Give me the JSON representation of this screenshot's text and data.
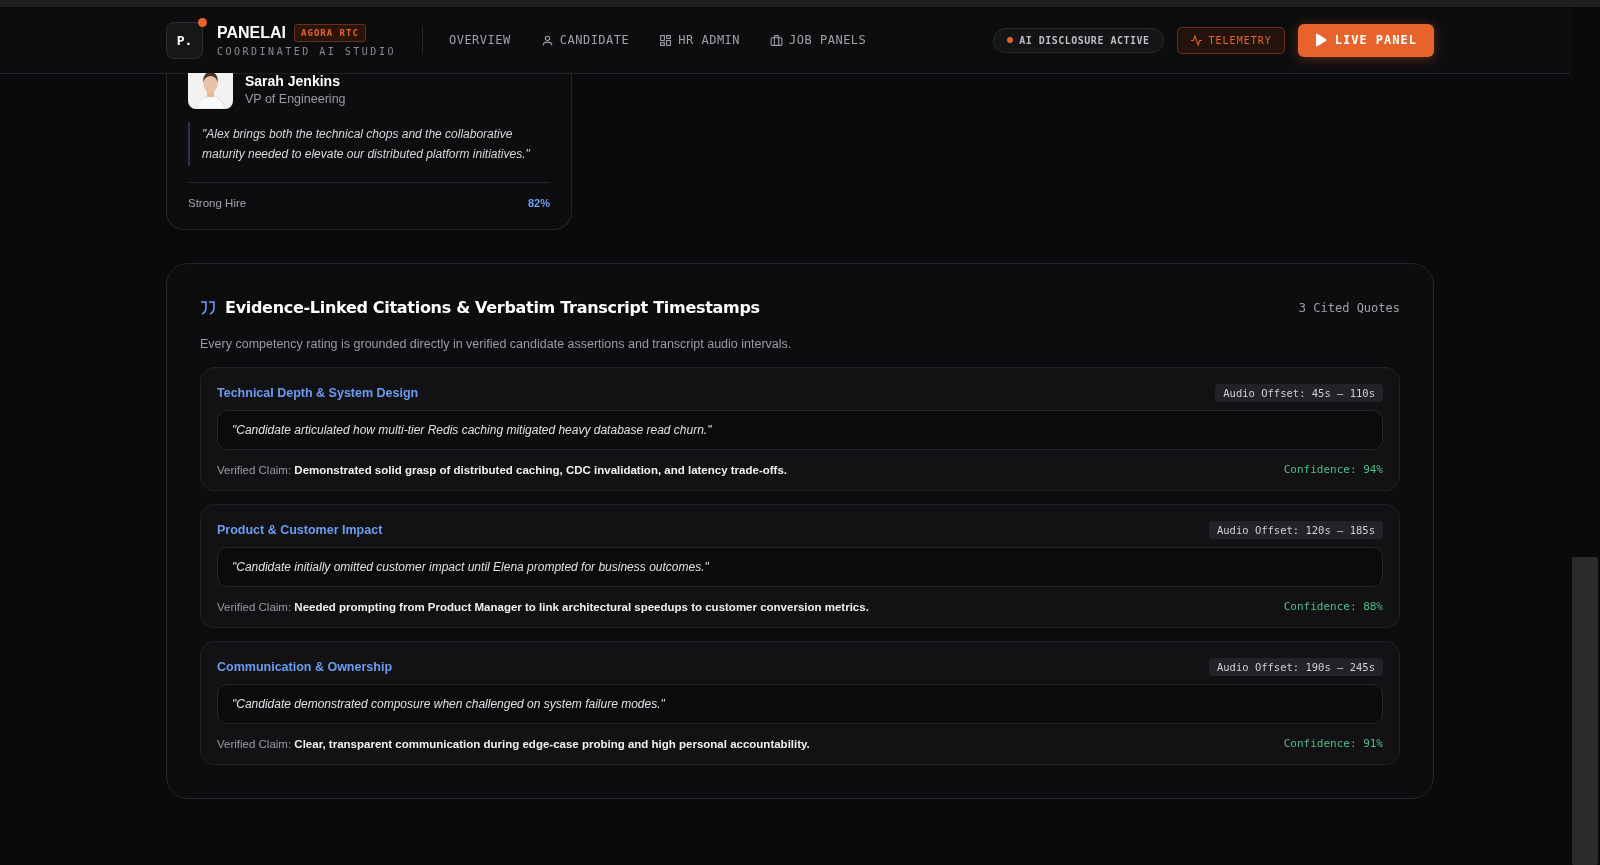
{
  "header": {
    "logo_mark": "P.",
    "brand": "PANELAI",
    "badge": "AGORA RTC",
    "tagline": "COORDINATED AI STUDIO",
    "nav": [
      {
        "label": "OVERVIEW"
      },
      {
        "label": "CANDIDATE"
      },
      {
        "label": "HR ADMIN"
      },
      {
        "label": "JOB PANELS"
      }
    ],
    "status_pill": "AI DISCLOSURE ACTIVE",
    "telemetry_button": "TELEMETRY",
    "live_button": "LIVE PANEL"
  },
  "reference_card": {
    "name": "Sarah Jenkins",
    "role": "VP of Engineering",
    "quote": "\"Alex brings both the technical chops and the collaborative maturity needed to elevate our distributed platform initiatives.\"",
    "verdict": "Strong Hire",
    "score": "82%"
  },
  "citations": {
    "title": "Evidence-Linked Citations & Verbatim Transcript Timestamps",
    "count": "3 Cited Quotes",
    "subtitle": "Every competency rating is grounded directly in verified candidate assertions and transcript audio intervals.",
    "items": [
      {
        "competency": "Technical Depth & System Design",
        "offset": "Audio Offset: 45s – 110s",
        "quote": "\"Candidate articulated how multi-tier Redis caching mitigated heavy database read churn.\"",
        "claim": "Verified Claim: **Demonstrated solid grasp of distributed caching, CDC invalidation, and latency trade-offs.**",
        "confidence": "Confidence: 94%"
      },
      {
        "competency": "Product & Customer Impact",
        "offset": "Audio Offset: 120s – 185s",
        "quote": "\"Candidate initially omitted customer impact until Elena prompted for business outcomes.\"",
        "claim": "Verified Claim: **Needed prompting from Product Manager to link architectural speedups to customer conversion metrics.**",
        "confidence": "Confidence: 88%"
      },
      {
        "competency": "Communication & Ownership",
        "offset": "Audio Offset: 190s – 245s",
        "quote": "\"Candidate demonstrated composure when challenged on system failure modes.\"",
        "claim": "Verified Claim: **Clear, transparent communication during edge-case probing and high personal accountability.**",
        "confidence": "Confidence: 91%"
      }
    ]
  }
}
